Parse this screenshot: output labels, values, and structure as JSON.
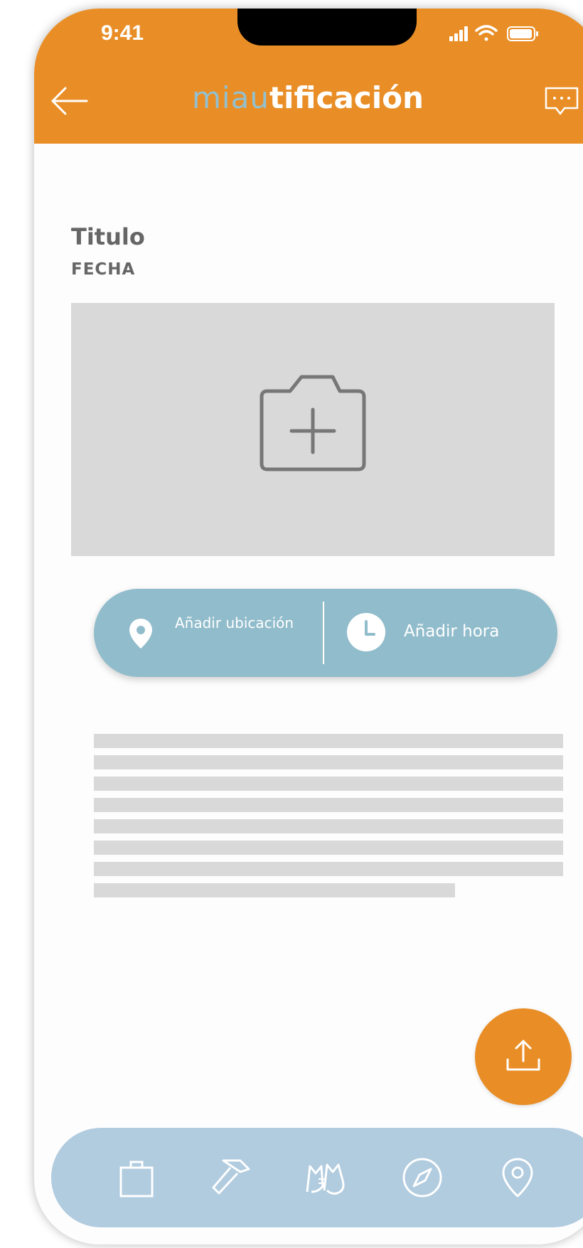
{
  "status_bar": {
    "time": "9:41"
  },
  "header": {
    "title_part1": "miau",
    "title_part2": "tificación"
  },
  "page": {
    "title": "Titulo",
    "date": "FECHA"
  },
  "actions": {
    "location_label": "Añadir ubicación",
    "time_label": "Añadir hora"
  },
  "icons": {
    "back": "arrow-left-icon",
    "chat": "chat-bubble-icon",
    "photo": "camera-plus-icon",
    "location": "map-pin-icon",
    "time": "clock-icon",
    "share": "upload-icon",
    "nav": [
      "shopping-bag-icon",
      "hammer-icon",
      "cats-icon",
      "compass-icon",
      "location-pin-icon"
    ]
  },
  "colors": {
    "header": "#E98E26",
    "accent_blue": "#91BCCB",
    "nav_bar": "#B1CBDF",
    "placeholder": "#D9D9D9",
    "text": "#666666"
  }
}
